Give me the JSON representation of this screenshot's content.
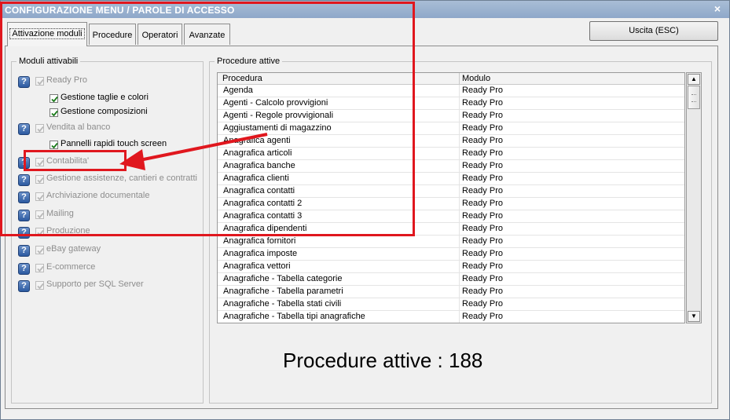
{
  "window": {
    "title": "CONFIGURAZIONE MENU / PAROLE DI ACCESSO",
    "close_glyph": "×"
  },
  "tabs": [
    {
      "label": "Attivazione moduli",
      "active": true
    },
    {
      "label": "Procedure",
      "active": false
    },
    {
      "label": "Operatori",
      "active": false
    },
    {
      "label": "Avanzate",
      "active": false
    }
  ],
  "exit_button": {
    "label": "Uscita (ESC)"
  },
  "modules_group": {
    "title": "Moduli attivabili",
    "help_glyph": "?",
    "items": [
      {
        "label": "Ready Pro",
        "checked": true,
        "enabled": false,
        "help": true
      },
      {
        "label": "Gestione taglie e colori",
        "checked": true,
        "enabled": true,
        "help": false
      },
      {
        "label": "Gestione composizioni",
        "checked": true,
        "enabled": true,
        "help": false
      },
      {
        "label": "Vendita al banco",
        "checked": true,
        "enabled": false,
        "help": true
      },
      {
        "label": "Pannelli rapidi touch screen",
        "checked": true,
        "enabled": true,
        "help": false
      },
      {
        "label": "Contabilita'",
        "checked": true,
        "enabled": false,
        "help": true
      },
      {
        "label": "Gestione assistenze, cantieri e contratti",
        "checked": true,
        "enabled": false,
        "help": true
      },
      {
        "label": "Archiviazione documentale",
        "checked": true,
        "enabled": false,
        "help": true
      },
      {
        "label": "Mailing",
        "checked": true,
        "enabled": false,
        "help": true
      },
      {
        "label": "Produzione",
        "checked": true,
        "enabled": false,
        "help": true
      },
      {
        "label": "eBay gateway",
        "checked": true,
        "enabled": false,
        "help": true
      },
      {
        "label": "E-commerce",
        "checked": true,
        "enabled": false,
        "help": true
      },
      {
        "label": "Supporto per SQL Server",
        "checked": true,
        "enabled": false,
        "help": true
      }
    ]
  },
  "procedures_group": {
    "title": "Procedure attive",
    "columns": [
      "Procedura",
      "Modulo"
    ],
    "rows": [
      [
        "Agenda",
        "Ready Pro"
      ],
      [
        "Agenti - Calcolo provvigioni",
        "Ready Pro"
      ],
      [
        "Agenti - Regole provvigionali",
        "Ready Pro"
      ],
      [
        "Aggiustamenti di magazzino",
        "Ready Pro"
      ],
      [
        "Anagrafica agenti",
        "Ready Pro"
      ],
      [
        "Anagrafica articoli",
        "Ready Pro"
      ],
      [
        "Anagrafica banche",
        "Ready Pro"
      ],
      [
        "Anagrafica clienti",
        "Ready Pro"
      ],
      [
        "Anagrafica contatti",
        "Ready Pro"
      ],
      [
        "Anagrafica contatti 2",
        "Ready Pro"
      ],
      [
        "Anagrafica contatti 3",
        "Ready Pro"
      ],
      [
        "Anagrafica dipendenti",
        "Ready Pro"
      ],
      [
        "Anagrafica fornitori",
        "Ready Pro"
      ],
      [
        "Anagrafica imposte",
        "Ready Pro"
      ],
      [
        "Anagrafica vettori",
        "Ready Pro"
      ],
      [
        "Anagrafiche - Tabella categorie",
        "Ready Pro"
      ],
      [
        "Anagrafiche - Tabella parametri",
        "Ready Pro"
      ],
      [
        "Anagrafiche - Tabella stati civili",
        "Ready Pro"
      ],
      [
        "Anagrafiche - Tabella tipi anagrafiche",
        "Ready Pro"
      ]
    ],
    "scroll_up_glyph": "▲",
    "scroll_down_glyph": "▼",
    "count_text": "Procedure attive : 188"
  },
  "annotation_color": "#e0171e"
}
